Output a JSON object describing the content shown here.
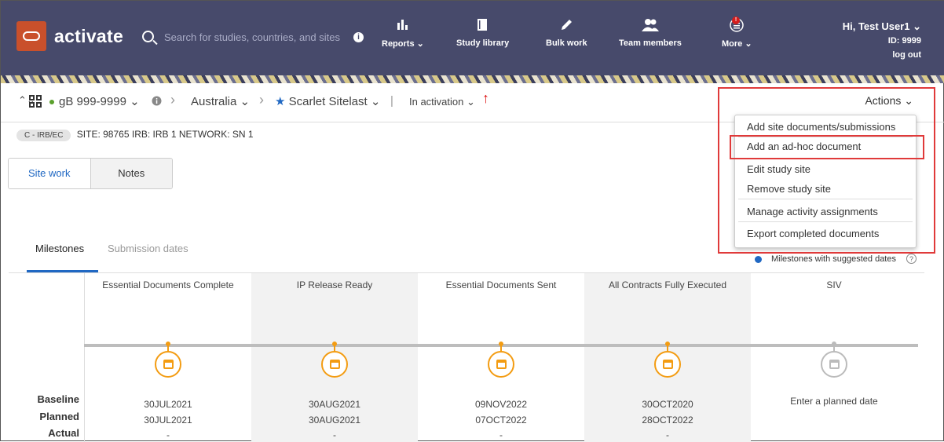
{
  "header": {
    "brand": "activate",
    "search_placeholder": "Search for studies, countries, and sites",
    "info_icon": "i",
    "nav": [
      {
        "label": "Reports",
        "caret": "⌄",
        "icon": "bar-chart-icon"
      },
      {
        "label": "Study library",
        "icon": "book-icon"
      },
      {
        "label": "Bulk work",
        "icon": "pencil-icon"
      },
      {
        "label": "Team members",
        "icon": "users-icon"
      },
      {
        "label": "More",
        "caret": "⌄",
        "icon": "list-icon",
        "badge": "!"
      }
    ],
    "user": {
      "greeting": "Hi, Test User1",
      "id": "ID: 9999",
      "logout": "log out"
    }
  },
  "context": {
    "study": "gB 999-9999",
    "country": "Australia",
    "site": "Scarlet Sitelast",
    "status": "In activation",
    "actions_label": "Actions"
  },
  "tags": {
    "pill": "C - IRB/EC",
    "site": "SITE: 98765",
    "irb": "IRB: IRB 1",
    "network": "NETWORK: SN 1"
  },
  "tabs": {
    "site_work": "Site work",
    "notes": "Notes"
  },
  "subtabs": {
    "milestones": "Milestones",
    "submission_dates": "Submission dates"
  },
  "legend": "Milestones with suggested dates",
  "help": "?",
  "row_labels": {
    "baseline": "Baseline",
    "planned": "Planned",
    "actual": "Actual"
  },
  "milestones": [
    {
      "title": "Essential Documents Complete",
      "baseline": "30JUL2021",
      "planned": "30JUL2021",
      "actual": "-"
    },
    {
      "title": "IP Release Ready",
      "baseline": "30AUG2021",
      "planned": "30AUG2021",
      "actual": "-"
    },
    {
      "title": "Essential Documents Sent",
      "baseline": "09NOV2022",
      "planned": "07OCT2022",
      "actual": "-"
    },
    {
      "title": "All Contracts Fully Executed",
      "baseline": "30OCT2020",
      "planned": "28OCT2022",
      "actual": "-"
    },
    {
      "title": "SIV",
      "note": "Enter a planned date"
    }
  ],
  "actions_menu": [
    "Add site documents/submissions",
    "Add an ad-hoc document",
    "Edit study site",
    "Remove study site",
    "Manage activity assignments",
    "Export completed documents"
  ],
  "colors": {
    "header": "#474a6b",
    "brand": "#c9502b",
    "accent": "#2068c3",
    "milestone": "#f39c12",
    "highlight": "#e03a3a"
  }
}
